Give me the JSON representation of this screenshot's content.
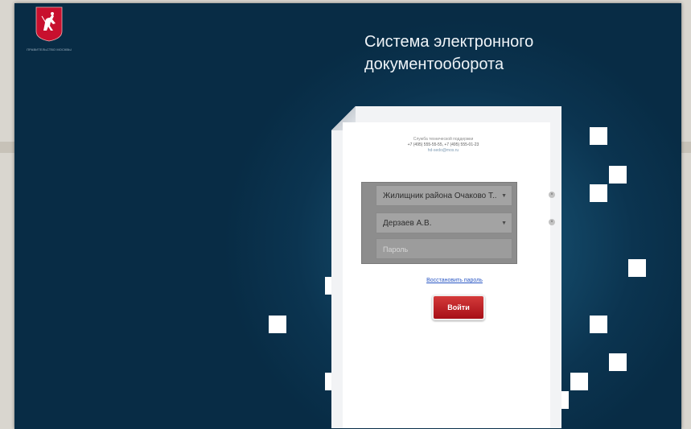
{
  "logo": {
    "caption": "ПРАВИТЕЛЬСТВО МОСКВЫ",
    "colors": {
      "shield": "#c8102e",
      "rider": "#ffffff"
    }
  },
  "header": {
    "title_line1": "Система электронного",
    "title_line2": "документооборота"
  },
  "support": {
    "label": "Служба технической поддержки",
    "phones": "+7 (495) 555-55-55, +7 (495) 555-01-23",
    "email": "hd-sedo@mos.ru"
  },
  "form": {
    "organization": "Жилищник района Очаково Т..",
    "user": "Дерзаев А.В.",
    "password_placeholder": "Пароль",
    "restore_link": "Восстановить пароль",
    "login_button": "Войти",
    "clear_icon": "×",
    "caret_icon": "▼"
  },
  "colors": {
    "background": "#0b3450",
    "accent": "#c4141c",
    "link": "#2a57c4"
  }
}
